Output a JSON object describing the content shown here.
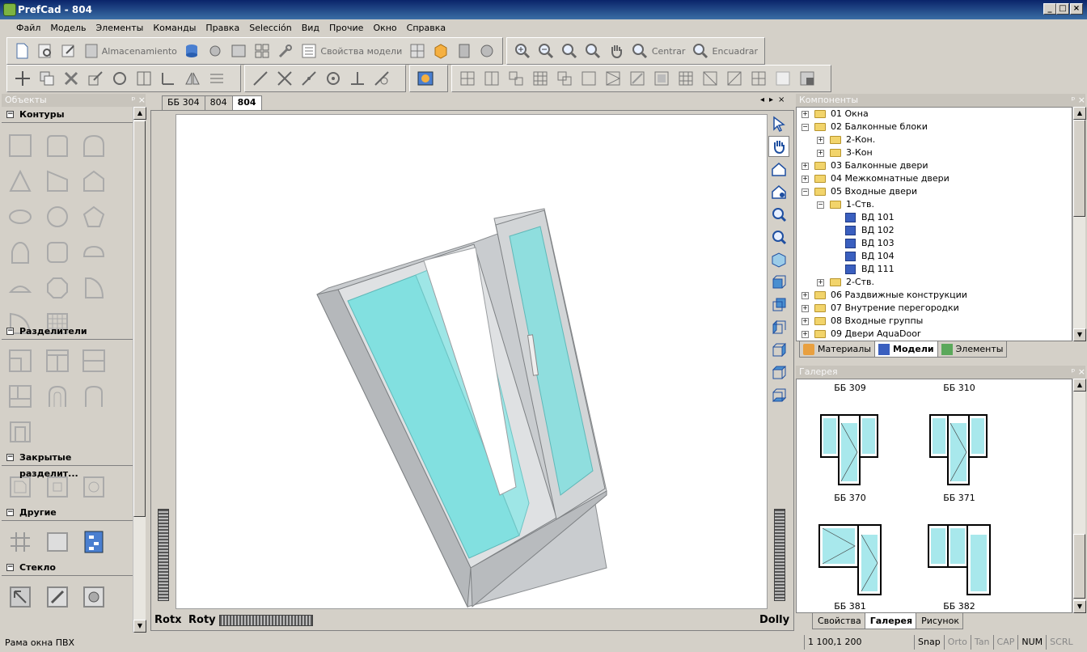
{
  "window": {
    "title": "PrefCad - 804",
    "min": "_",
    "max": "□",
    "close": "×"
  },
  "menu": [
    "Файл",
    "Модель",
    "Элементы",
    "Команды",
    "Правка",
    "Selección",
    "Вид",
    "Прочие",
    "Окно",
    "Справка"
  ],
  "toolbar1": {
    "storage_label": "Almacenamiento",
    "model_props_label": "Свойства модели",
    "center_label": "Centrar",
    "fit_label": "Encuadrar"
  },
  "objects_panel": {
    "title": "Объекты",
    "categories": [
      "Контуры",
      "Разделители",
      "Закрытые разделит...",
      "Другие",
      "Стекло"
    ]
  },
  "document": {
    "tabs": [
      "ББ 304",
      "804",
      "804"
    ],
    "active_tab": 2
  },
  "viewport": {
    "rotx": "Rotx",
    "roty": "Roty",
    "dolly": "Dolly"
  },
  "components": {
    "title": "Компоненты",
    "tree": [
      {
        "label": "01 Окна",
        "level": 0,
        "exp": "+"
      },
      {
        "label": "02 Балконные блоки",
        "level": 0,
        "exp": "-"
      },
      {
        "label": "2-Кон.",
        "level": 1,
        "exp": "+"
      },
      {
        "label": "3-Кон",
        "level": 1,
        "exp": "+"
      },
      {
        "label": "03 Балконные двери",
        "level": 0,
        "exp": "+"
      },
      {
        "label": "04 Межкомнатные двери",
        "level": 0,
        "exp": "+"
      },
      {
        "label": "05 Входные двери",
        "level": 0,
        "exp": "-"
      },
      {
        "label": "1-Ств.",
        "level": 1,
        "exp": "-"
      },
      {
        "label": "ВД 101",
        "level": 2,
        "exp": ""
      },
      {
        "label": "ВД 102",
        "level": 2,
        "exp": ""
      },
      {
        "label": "ВД 103",
        "level": 2,
        "exp": ""
      },
      {
        "label": "ВД 104",
        "level": 2,
        "exp": ""
      },
      {
        "label": "ВД 111",
        "level": 2,
        "exp": ""
      },
      {
        "label": "2-Ств.",
        "level": 1,
        "exp": "+"
      },
      {
        "label": "06 Раздвижные конструкции",
        "level": 0,
        "exp": "+"
      },
      {
        "label": "07 Внутрение перегородки",
        "level": 0,
        "exp": "+"
      },
      {
        "label": "08 Входные группы",
        "level": 0,
        "exp": "+"
      },
      {
        "label": "09 Двери AquaDoor",
        "level": 0,
        "exp": "+"
      }
    ],
    "tabs": [
      "Материалы",
      "Модели",
      "Элементы"
    ],
    "active_tab": 1
  },
  "gallery": {
    "title": "Галерея",
    "items": [
      "ББ 309",
      "ББ 310",
      "ББ 370",
      "ББ 371",
      "ББ 381",
      "ББ 382"
    ],
    "tabs": [
      "Свойства",
      "Галерея",
      "Рисунок"
    ],
    "active_tab": 1
  },
  "status": {
    "text": "Рама окна ПВХ",
    "coords": "1 100,1 200",
    "snap": "Snap",
    "orto": "Orto",
    "tan": "Tan",
    "cap": "CAP",
    "num": "NUM",
    "scrl": "SCRL"
  }
}
